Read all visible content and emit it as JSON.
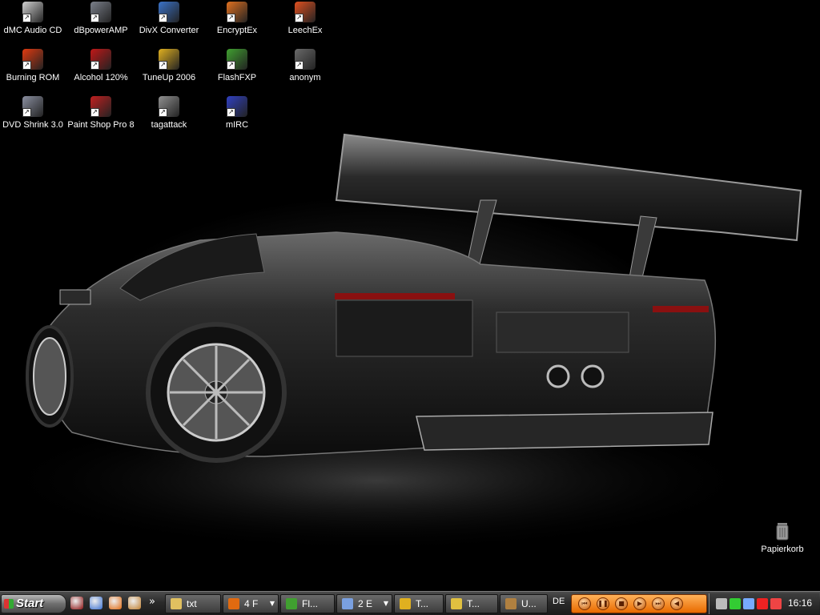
{
  "desktop": {
    "icons": [
      {
        "label": "dMC Audio CD",
        "icon": "cd-icon"
      },
      {
        "label": "dBpowerAMP",
        "icon": "speaker-icon"
      },
      {
        "label": "DivX Converter",
        "icon": "divx-icon"
      },
      {
        "label": "EncryptEx",
        "icon": "encryptex-icon"
      },
      {
        "label": "LeechEx",
        "icon": "leechex-icon"
      },
      {
        "label": "Burning ROM",
        "icon": "burning-rom-icon"
      },
      {
        "label": "Alcohol 120%",
        "icon": "alcohol-icon"
      },
      {
        "label": "TuneUp 2006",
        "icon": "tuneup-icon"
      },
      {
        "label": "FlashFXP",
        "icon": "flashfxp-icon"
      },
      {
        "label": "anonym",
        "icon": "text-file-icon"
      },
      {
        "label": "DVD Shrink 3.0",
        "icon": "dvd-shrink-icon"
      },
      {
        "label": "Paint Shop Pro 8",
        "icon": "paint-shop-pro-icon"
      },
      {
        "label": "tagattack",
        "icon": "tagattack-icon"
      },
      {
        "label": "mIRC",
        "icon": "mirc-icon"
      }
    ],
    "recycle_bin": {
      "label": "Papierkorb",
      "icon": "recycle-bin-icon"
    },
    "wallpaper": "sports-car-wallpaper"
  },
  "taskbar": {
    "start_label": "Start",
    "quick_launch": [
      "shield-icon",
      "ie-icon",
      "firefox-icon",
      "monkey-icon"
    ],
    "quick_launch_more": "»",
    "buttons": [
      {
        "label": "txt",
        "icon": "folder-icon",
        "grouped": false
      },
      {
        "label": "4 F",
        "icon": "firefox-icon",
        "grouped": true
      },
      {
        "label": "Fl...",
        "icon": "flashfxp-icon",
        "grouped": false
      },
      {
        "label": "2 E",
        "icon": "notepad-icon",
        "grouped": true
      },
      {
        "label": "T...",
        "icon": "tuneup-icon",
        "grouped": false
      },
      {
        "label": "T...",
        "icon": "mail-icon",
        "grouped": false
      },
      {
        "label": "U...",
        "icon": "utility-icon",
        "grouped": false
      }
    ],
    "language": "DE",
    "media_controls": [
      "previous-icon",
      "pause-icon",
      "stop-icon",
      "play-icon",
      "next-icon",
      "volume-icon"
    ],
    "tray_icons": [
      "arrow-icon",
      "battery-icon",
      "network-icon",
      "ati-icon",
      "aim-icon"
    ],
    "clock": "16:16"
  },
  "colors": {
    "taskbar": "#2b2b2b",
    "media_bar": "#e86a00",
    "icon_label": "#ffffff"
  }
}
